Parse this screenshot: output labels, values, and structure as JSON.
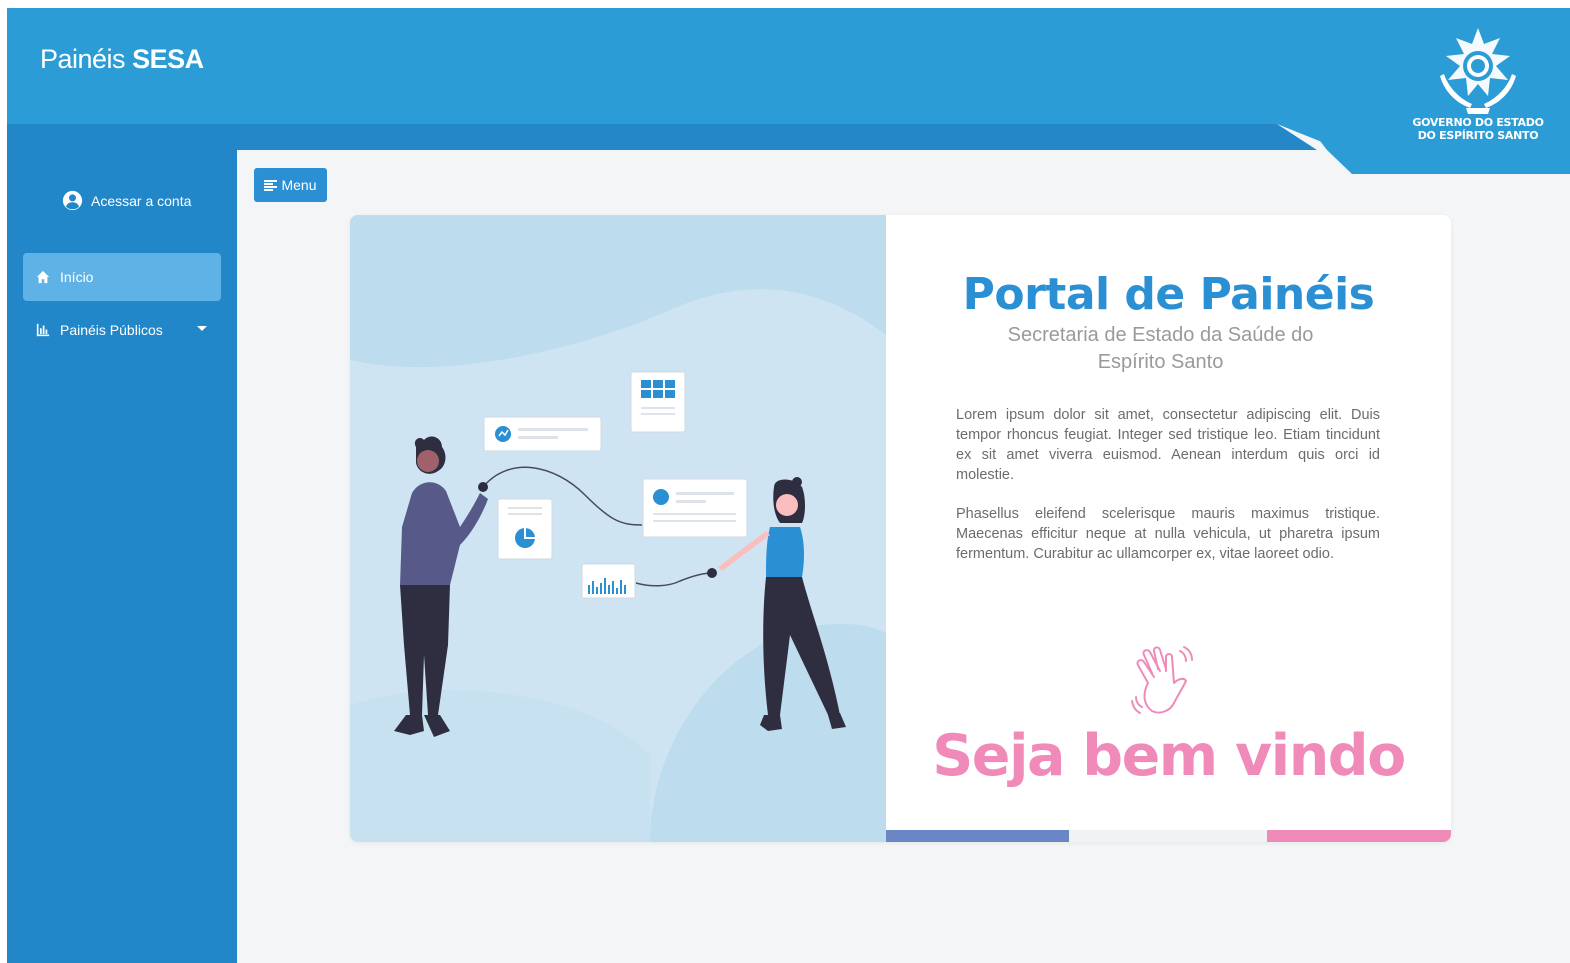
{
  "header": {
    "brand_light": "Painéis",
    "brand_bold": "SESA",
    "gov_line1": "GOVERNO DO ESTADO",
    "gov_line2": "DO ESPÍRITO SANTO"
  },
  "sidebar": {
    "account_label": "Acessar a conta",
    "items": [
      {
        "label": "Início",
        "icon": "home-icon",
        "active": true
      },
      {
        "label": "Painéis Públicos",
        "icon": "bar-chart-icon",
        "has_dropdown": true
      }
    ]
  },
  "toolbar": {
    "menu_label": "Menu"
  },
  "main": {
    "title": "Portal de Painéis",
    "subtitle": "Secretaria de Estado da Saúde do Espírito Santo",
    "paragraph1": "Lorem ipsum dolor sit amet, consectetur adipiscing elit. Duis tempor rhoncus feugiat. Integer sed tristique leo. Etiam tincidunt ex sit amet viverra euismod. Aenean interdum quis orci id molestie.",
    "paragraph2": "Phasellus eleifend scelerisque mauris maximus tristique. Maecenas efficitur neque at nulla vehicula, ut pharetra ipsum fermentum. Curabitur ac ullamcorper ex, vitae laoreet odio.",
    "welcome": "Seja bem vindo"
  },
  "colors": {
    "header": "#2c9cd6",
    "sidebar": "#2287c9",
    "accent_blue": "#2a8fd3",
    "accent_pink": "#f08bb9",
    "bar_blue": "#6b86c6",
    "bar_light": "#f1f2f3"
  }
}
